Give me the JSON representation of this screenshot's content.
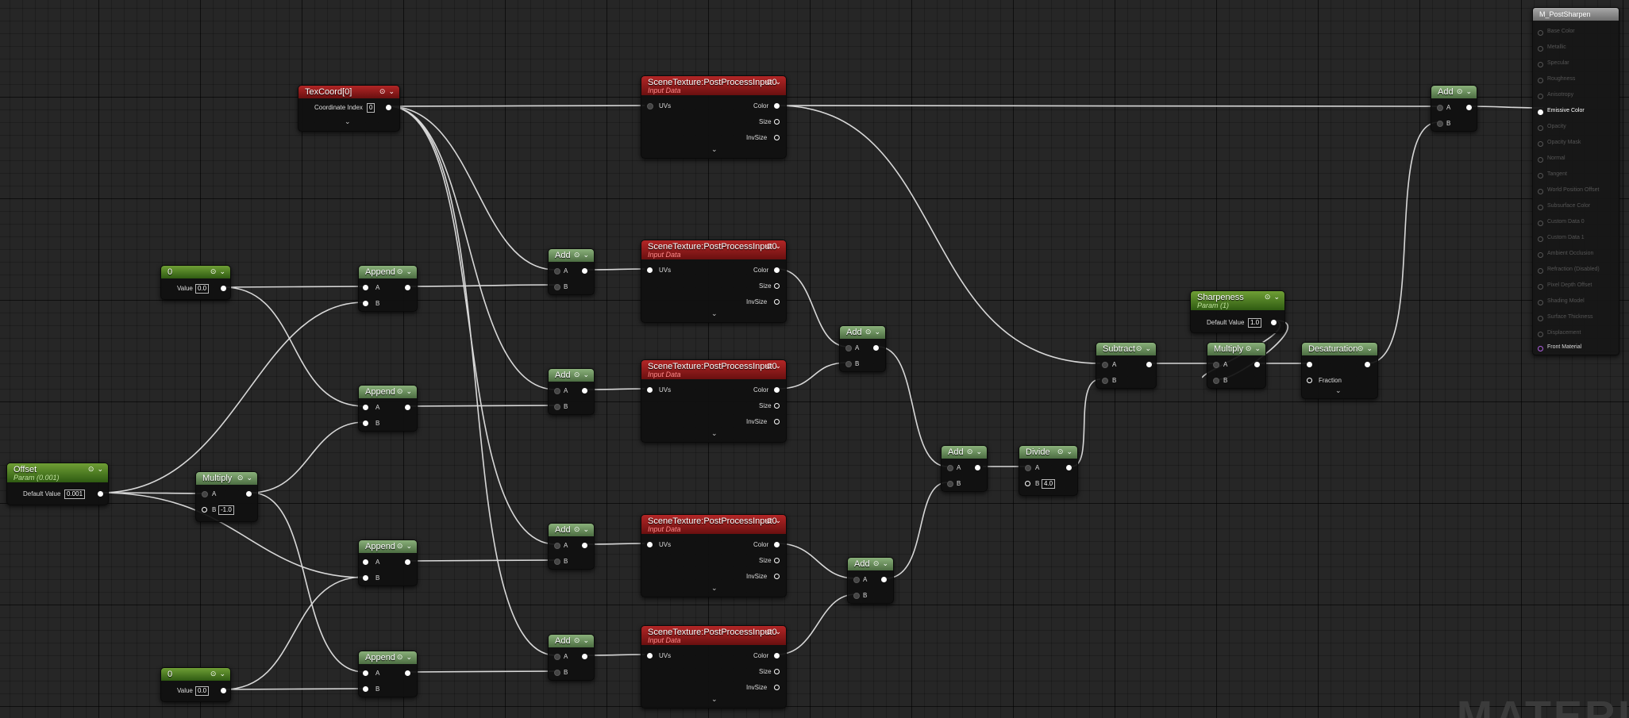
{
  "graph": {
    "watermark": "MATERIAL"
  },
  "nodes": {
    "texcoord": {
      "title": "TexCoord[0]",
      "coord_label": "Coordinate Index",
      "coord_value": "0"
    },
    "scene1": {
      "title": "SceneTexture:PostProcessInput0",
      "subtitle": "Input Data",
      "uvs": "UVs",
      "color": "Color",
      "size": "Size",
      "invsize": "InvSize"
    },
    "scene2": {
      "title": "SceneTexture:PostProcessInput0",
      "subtitle": "Input Data",
      "uvs": "UVs",
      "color": "Color",
      "size": "Size",
      "invsize": "InvSize"
    },
    "scene3": {
      "title": "SceneTexture:PostProcessInput0",
      "subtitle": "Input Data",
      "uvs": "UVs",
      "color": "Color",
      "size": "Size",
      "invsize": "InvSize"
    },
    "scene4": {
      "title": "SceneTexture:PostProcessInput0",
      "subtitle": "Input Data",
      "uvs": "UVs",
      "color": "Color",
      "size": "Size",
      "invsize": "InvSize"
    },
    "scene5": {
      "title": "SceneTexture:PostProcessInput0",
      "subtitle": "Input Data",
      "uvs": "UVs",
      "color": "Color",
      "size": "Size",
      "invsize": "InvSize"
    },
    "const_top": {
      "title": "0",
      "value_label": "Value",
      "value": "0.0"
    },
    "const_bottom": {
      "title": "0",
      "value_label": "Value",
      "value": "0.0"
    },
    "offset": {
      "title": "Offset",
      "subtitle": "Param (0.001)",
      "value_label": "Default Value",
      "value": "0.001"
    },
    "multiply_left": {
      "title": "Multiply",
      "a": "A",
      "b": "B",
      "b_value": "-1.0"
    },
    "append1": {
      "title": "Append",
      "a": "A",
      "b": "B"
    },
    "append2": {
      "title": "Append",
      "a": "A",
      "b": "B"
    },
    "append3": {
      "title": "Append",
      "a": "A",
      "b": "B"
    },
    "append4": {
      "title": "Append",
      "a": "A",
      "b": "B"
    },
    "add_uv1": {
      "title": "Add",
      "a": "A",
      "b": "B"
    },
    "add_uv2": {
      "title": "Add",
      "a": "A",
      "b": "B"
    },
    "add_uv3": {
      "title": "Add",
      "a": "A",
      "b": "B"
    },
    "add_uv4": {
      "title": "Add",
      "a": "A",
      "b": "B"
    },
    "add_c1": {
      "title": "Add",
      "a": "A",
      "b": "B"
    },
    "add_c2": {
      "title": "Add",
      "a": "A",
      "b": "B"
    },
    "add_c3": {
      "title": "Add",
      "a": "A",
      "b": "B"
    },
    "divide": {
      "title": "Divide",
      "a": "A",
      "b": "B",
      "b_value": "4.0"
    },
    "subtract": {
      "title": "Subtract",
      "a": "A",
      "b": "B"
    },
    "sharpeness": {
      "title": "Sharpeness",
      "subtitle": "Param (1)",
      "value_label": "Default Value",
      "value": "1.0"
    },
    "multiply_right": {
      "title": "Multiply",
      "a": "A",
      "b": "B"
    },
    "desaturation": {
      "title": "Desaturation",
      "fraction": "Fraction"
    },
    "add_final": {
      "title": "Add",
      "a": "A",
      "b": "B"
    }
  },
  "material": {
    "title": "M_PostSharpen",
    "pins": [
      "Base Color",
      "Metallic",
      "Specular",
      "Roughness",
      "Anisotropy",
      "Emissive Color",
      "Opacity",
      "Opacity Mask",
      "Normal",
      "Tangent",
      "World Position Offset",
      "Subsurface Color",
      "Custom Data 0",
      "Custom Data 1",
      "Ambient Occlusion",
      "Refraction (Disabled)",
      "Pixel Depth Offset",
      "Shading Model",
      "Surface Thickness",
      "Displacement",
      "Front Material"
    ]
  },
  "icons": {
    "header_dot": "circle-icon",
    "header_chevron": "chevron-down-icon",
    "expand": "chevron-down-icon"
  }
}
